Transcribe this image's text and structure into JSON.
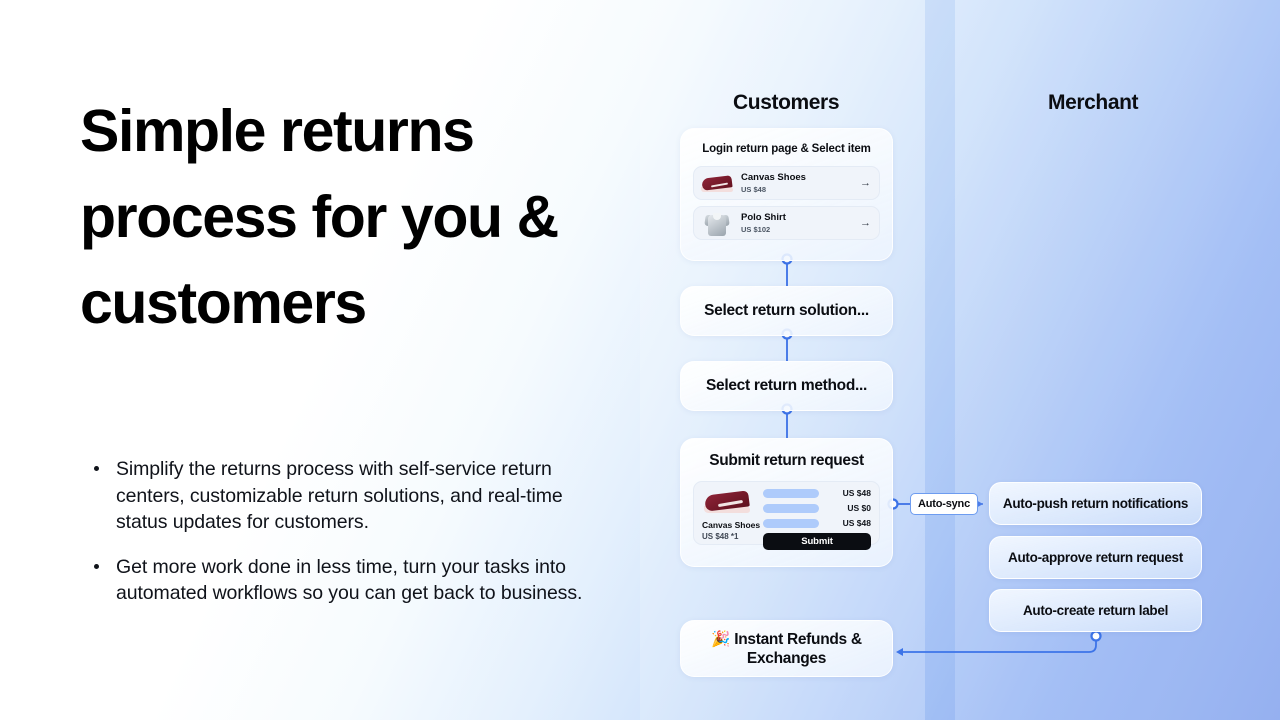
{
  "headline": "Simple returns process for you & customers",
  "bullets": [
    "Simplify the returns process with self-service return centers, customizable return solutions, and real-time status updates for customers.",
    "Get more work done in less time, turn your tasks into automated workflows so you can get back to business."
  ],
  "columns": {
    "customers_title": "Customers",
    "merchant_title": "Merchant"
  },
  "customer_flow": {
    "login_card": {
      "title": "Login return page & Select item",
      "items": [
        {
          "name": "Canvas Shoes",
          "price": "US $48",
          "arrow": "→",
          "thumb": "shoe-thumbnail"
        },
        {
          "name": "Polo Shirt",
          "price": "US $102",
          "arrow": "→",
          "thumb": "shirt-thumbnail"
        }
      ]
    },
    "step_solution": "Select return solution...",
    "step_method": "Select return method...",
    "submit_card": {
      "title": "Submit return request",
      "product_name": "Canvas Shoes",
      "product_price": "US $48 *1",
      "amounts": [
        "US $48",
        "US $0",
        "US $48"
      ],
      "button": "Submit"
    },
    "instant": {
      "emoji": "🎉",
      "line1": "Instant Refunds &",
      "line2": "Exchanges"
    }
  },
  "merchant_flow": {
    "sync_label": "Auto-sync",
    "nodes": [
      "Auto-push return notifications",
      "Auto-approve return request",
      "Auto-create return label"
    ]
  },
  "colors": {
    "accent_blue": "#3d74e8",
    "underline": "#b9d2f7",
    "bar_blue": "#aecbfb",
    "button_dark": "#0b0d12",
    "bg_right": "#8aa8ef"
  }
}
